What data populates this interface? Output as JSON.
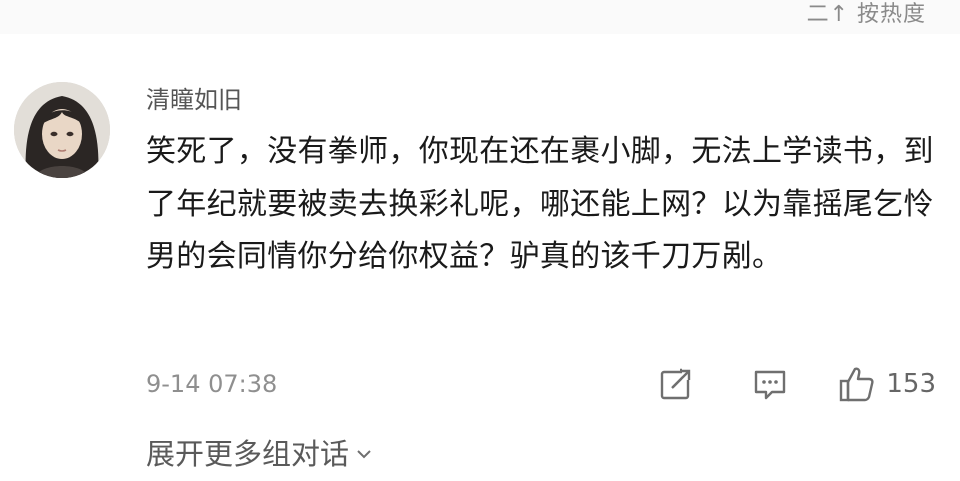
{
  "header": {
    "sort_label": "二↑ 按热度"
  },
  "comment": {
    "username": "清瞳如旧",
    "text": "笑死了，没有拳师，你现在还在裹小脚，无法上学读书，到了年纪就要被卖去换彩礼呢，哪还能上网？以为靠摇尾乞怜男的会同情你分给你权益？驴真的该千刀万剐。",
    "timestamp": "9-14 07:38",
    "like_count": "153",
    "icons": {
      "share": "share-icon",
      "reply": "comment-icon",
      "like": "thumbs-up-icon",
      "expand": "chevron-down-icon"
    }
  },
  "footer": {
    "expand_label": "展开更多组对话"
  }
}
